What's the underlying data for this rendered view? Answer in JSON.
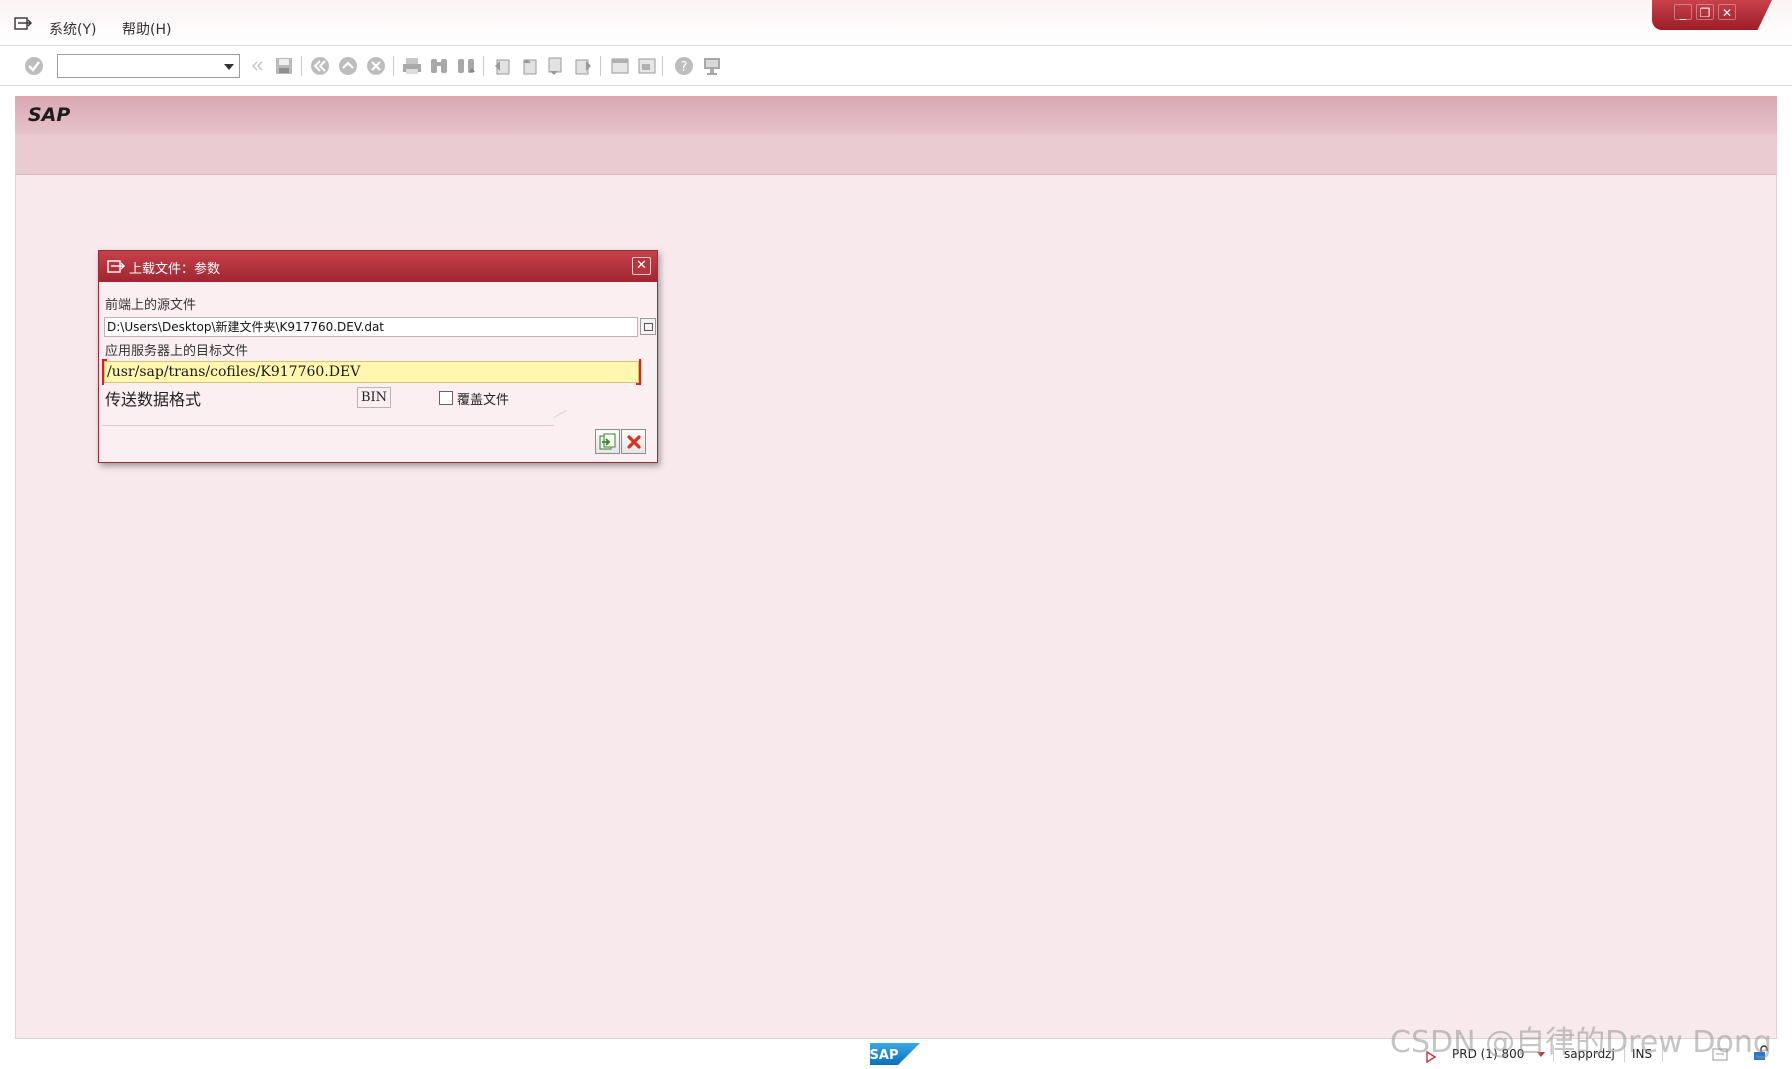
{
  "menu": {
    "items": [
      {
        "label": "系统(Y)"
      },
      {
        "label": "帮助(H)"
      }
    ]
  },
  "window_controls": {
    "minimize": "_",
    "restore": "❐",
    "close": "✕"
  },
  "toolbar": {
    "command_field_value": "",
    "icons": [
      "enter-icon",
      "back-icon",
      "save-icon",
      "exit-icon",
      "cancel-icon",
      "print-icon",
      "find-icon",
      "find-next-icon",
      "first-page-icon",
      "previous-page-icon",
      "next-page-icon",
      "last-page-icon",
      "create-session-icon",
      "shortcut-icon",
      "help-icon",
      "customize-layout-icon"
    ]
  },
  "title": "SAP",
  "dialog": {
    "title": "上载文件：参数",
    "source_label": "前端上的源文件",
    "source_value": "D:\\Users\\Desktop\\新建文件夹\\K917760.DEV.dat",
    "target_label": "应用服务器上的目标文件",
    "target_value": "/usr/sap/trans/cofiles/K917760.DEV",
    "format_label": "传送数据格式",
    "format_value": "BIN",
    "overwrite_label": "覆盖文件",
    "overwrite_checked": false,
    "confirm_icon": "transfer-icon",
    "cancel_icon": "cancel-icon"
  },
  "status": {
    "system": "PRD (1) 800",
    "server": "sapprdzj",
    "mode": "INS",
    "logo_text": "SAP"
  },
  "watermark": "CSDN @自律的Drew Dong",
  "colors": {
    "accent": "#a02631",
    "title_bar": "#d9a8b3",
    "work_area": "#f7e9ec",
    "input_highlight": "#fff7b0"
  }
}
